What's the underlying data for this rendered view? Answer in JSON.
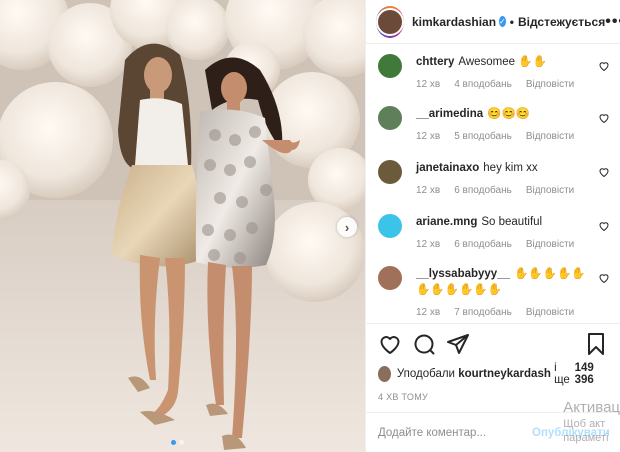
{
  "post": {
    "username": "kimkardashian",
    "separator": "•",
    "follow_label": "Відстежується",
    "more_label": "•••",
    "next_label": "›"
  },
  "comments": [
    {
      "user": "chttery",
      "text": "Awesomee ✋✋",
      "time": "12 хв",
      "likes": "4 вподобань",
      "reply": "Відповісти",
      "avatar_color": "#3f7a3a"
    },
    {
      "user": "__arimedina",
      "text": "😊😊😊",
      "time": "12 хв",
      "likes": "5 вподобань",
      "reply": "Відповісти",
      "avatar_color": "#5f7e5a"
    },
    {
      "user": "janetainaxo",
      "text": "hey kim xx",
      "time": "12 хв",
      "likes": "6 вподобань",
      "reply": "Відповісти",
      "avatar_color": "#6b5a3c"
    },
    {
      "user": "ariane.mng",
      "text": "So beautiful",
      "time": "12 хв",
      "likes": "6 вподобань",
      "reply": "Відповісти",
      "avatar_color": "#3bc4e8"
    },
    {
      "user": "__lyssababyyy__",
      "text": "✋✋✋✋✋✋✋✋✋✋✋",
      "time": "12 хв",
      "likes": "7 вподобань",
      "reply": "Відповісти",
      "avatar_color": "#a0705a"
    }
  ],
  "likes_line": {
    "prefix": "Уподобали",
    "user": "kourtneykardash",
    "middle": "і ще",
    "count": "149 396"
  },
  "timestamp": "4 ХВ ТОМУ",
  "add_comment": {
    "placeholder": "Додайте коментар...",
    "publish_label": "Опублікувати"
  },
  "watermark": {
    "title": "Активац",
    "subtitle": "Щоб акт",
    "subtitle2": "параметі"
  },
  "carousel": {
    "slides": 2,
    "active": 1
  },
  "colors": {
    "accent": "#3897f0",
    "muted": "#8e8e8e",
    "heart": "#262626"
  }
}
